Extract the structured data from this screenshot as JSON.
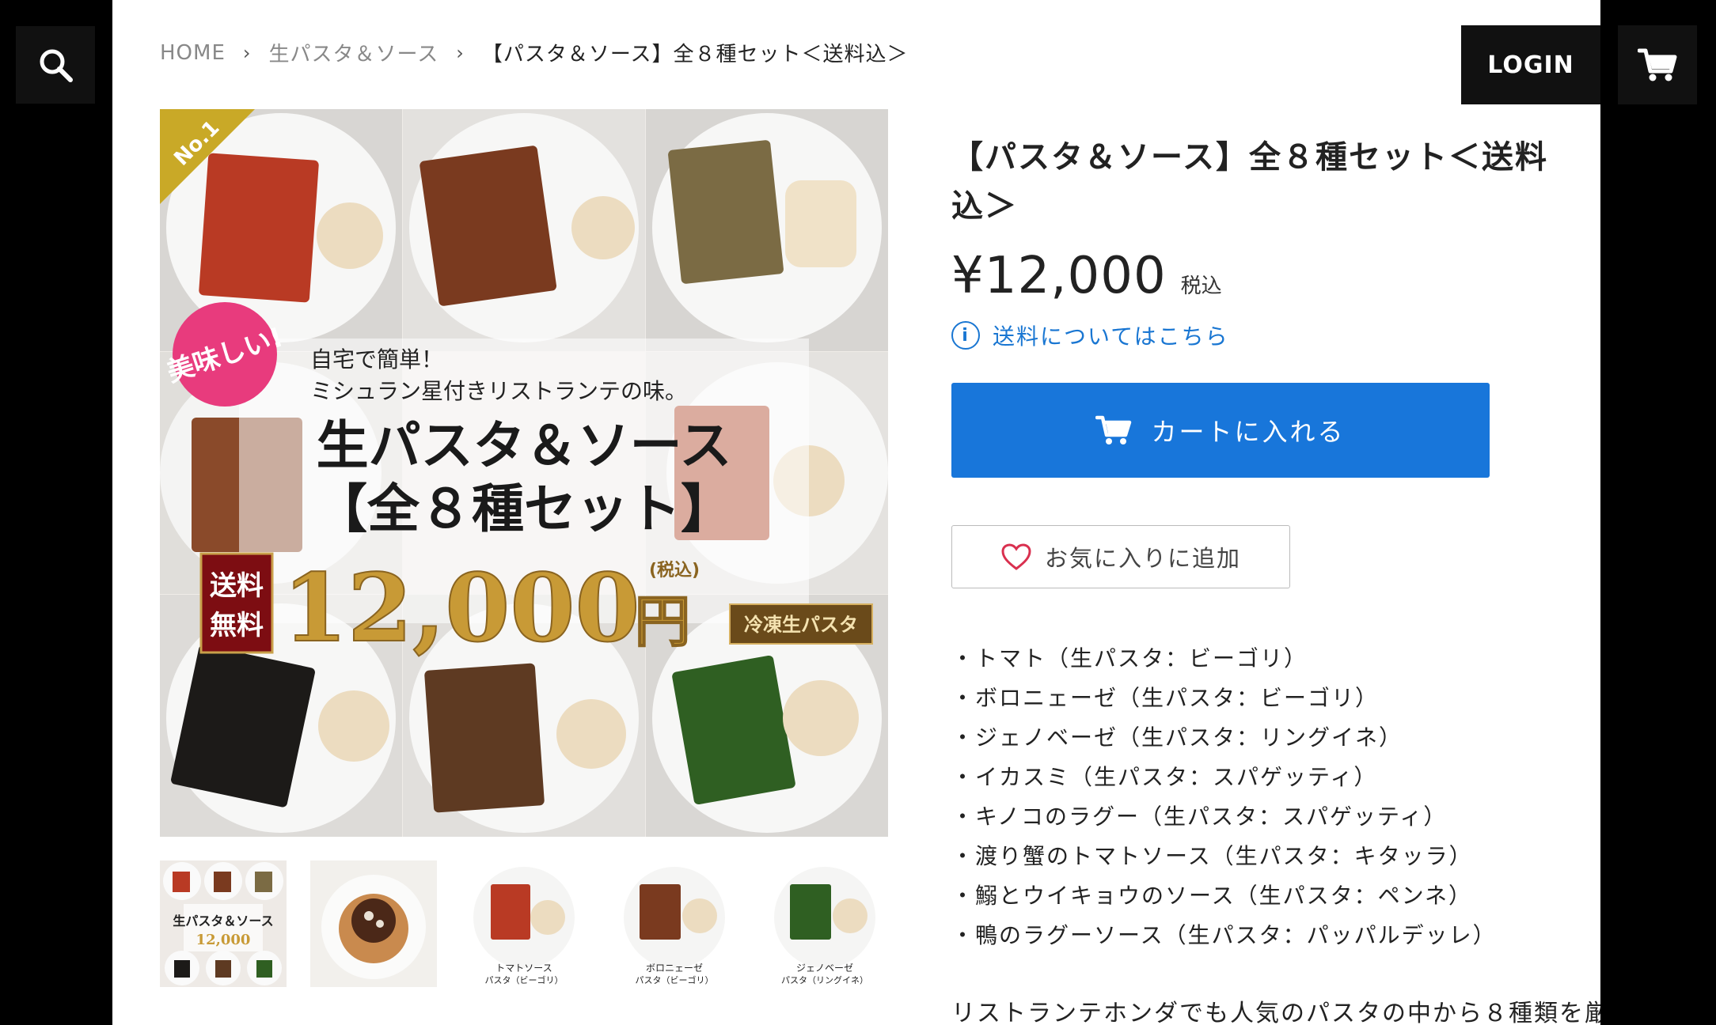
{
  "header": {
    "login_label": "LOGIN",
    "search_icon": "search-icon",
    "cart_icon": "cart-icon"
  },
  "breadcrumb": {
    "home": "HOME",
    "category": "生パスタ＆ソース",
    "current": "【パスタ＆ソース】全８種セット＜送料込＞",
    "separator": "›"
  },
  "product": {
    "title": "【パスタ＆ソース】全８種セット＜送料込＞",
    "price": "¥12,000",
    "tax_label": "税込",
    "shipping_link": "送料についてはこちら",
    "add_to_cart_label": "カートに入れる",
    "favorite_label": "お気に入りに追加",
    "items": [
      "・トマト（生パスタ：ビーゴリ）",
      "・ボロニェーゼ（生パスタ：ビーゴリ）",
      "・ジェノベーゼ（生パスタ：リングイネ）",
      "・イカスミ（生パスタ：スパゲッティ）",
      "・キノコのラグー（生パスタ：スパゲッティ）",
      "・渡り蟹のトマトソース（生パスタ：キタッラ）",
      "・鰯とウイキョウのソース（生パスタ：ペンネ）",
      "・鴨のラグーソース（生パスタ：パッパルデッレ）"
    ],
    "description_start": "リストランテホンダでも人気のパスタの中から８種類を厳"
  },
  "main_image": {
    "badge_rank": "No.1",
    "bubble": "美味しい!",
    "lead1": "自宅で簡単！",
    "lead2": "ミシュラン星付きリストランテの味。",
    "headline1": "生パスタ＆ソース",
    "headline2": "【全８種セット】",
    "free_shipping1": "送料",
    "free_shipping2": "無料",
    "price_big": "12,000",
    "price_unit": "円",
    "tax_note": "(税込)",
    "frozen_label": "冷凍生パスタ"
  },
  "thumbnails": [
    {
      "caption1": "",
      "caption2": ""
    },
    {
      "caption1": "",
      "caption2": ""
    },
    {
      "caption1": "トマトソース",
      "caption2": "パスタ（ビーゴリ）"
    },
    {
      "caption1": "ボロニェーゼ",
      "caption2": "パスタ（ビーゴリ）"
    },
    {
      "caption1": "ジェノベーゼ",
      "caption2": "パスタ（リングイネ）"
    }
  ],
  "colors": {
    "accent_blue": "#1876da",
    "link_blue": "#1976d2",
    "dark": "#111111",
    "heart": "#d9304f"
  }
}
